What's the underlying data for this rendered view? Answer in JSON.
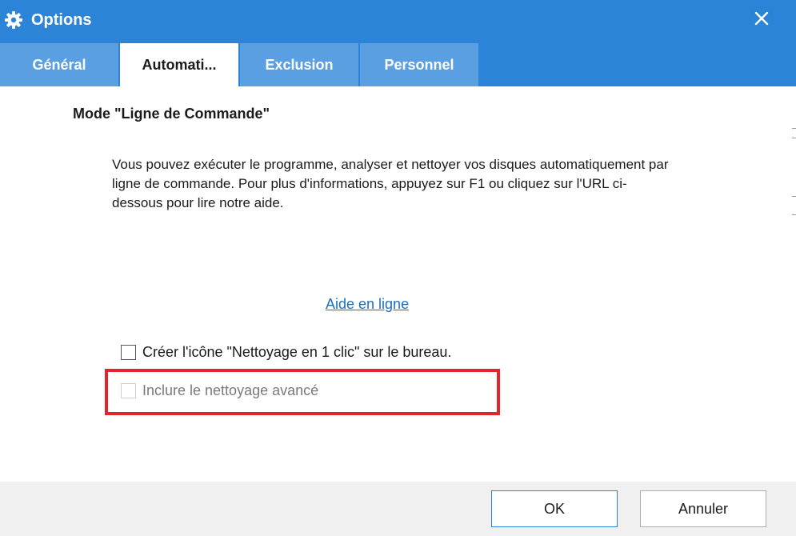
{
  "window": {
    "title": "Options",
    "icon": "gear-icon",
    "close_icon": "close-icon",
    "titlebar_color": "#2c84d8",
    "tab_color": "#5a9fe2"
  },
  "tabs": [
    {
      "label": "Général",
      "active": false
    },
    {
      "label": "Automati...",
      "active": true
    },
    {
      "label": "Exclusion",
      "active": false
    },
    {
      "label": "Personnel",
      "active": false
    }
  ],
  "main": {
    "section_title": "Mode \"Ligne de Commande\"",
    "description": "Vous pouvez exécuter le programme, analyser et nettoyer vos disques automatiquement par ligne de commande. Pour plus d'informations, appuyez sur F1 ou cliquez sur l'URL ci-dessous pour lire notre aide.",
    "help_link": "Aide en ligne",
    "options": [
      {
        "label": "Créer l'icône \"Nettoyage en 1 clic\" sur le bureau.",
        "checked": false,
        "enabled": true
      },
      {
        "label": "Inclure le nettoyage avancé",
        "checked": false,
        "enabled": false
      }
    ],
    "highlight_color": "#e0252f"
  },
  "footer": {
    "ok_label": "OK",
    "cancel_label": "Annuler"
  }
}
